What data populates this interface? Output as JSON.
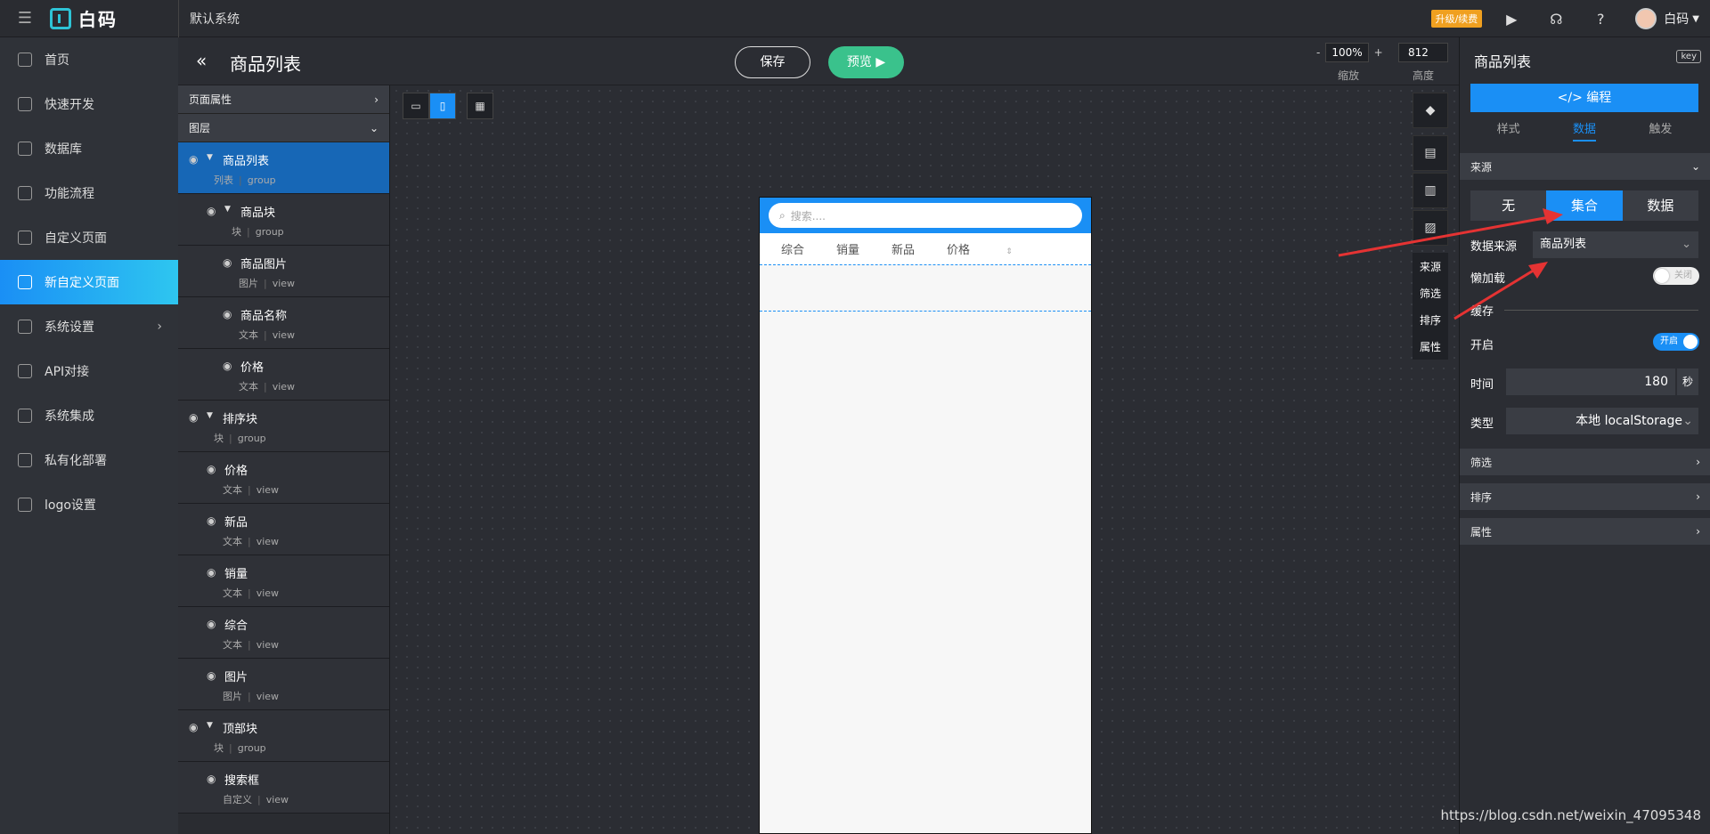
{
  "topbar": {
    "system": "默认系统",
    "logo": "白码",
    "upgrade": "升级/续费",
    "user": "白码"
  },
  "sidebar": {
    "items": [
      {
        "label": "首页",
        "icon": "home-icon"
      },
      {
        "label": "快速开发",
        "icon": "cube-icon"
      },
      {
        "label": "数据库",
        "icon": "database-icon"
      },
      {
        "label": "功能流程",
        "icon": "flow-icon"
      },
      {
        "label": "自定义页面",
        "icon": "page-icon"
      },
      {
        "label": "新自定义页面",
        "icon": "new-page-icon",
        "active": true
      },
      {
        "label": "系统设置",
        "icon": "chart-icon",
        "arrow": true
      },
      {
        "label": "API对接",
        "icon": "api-icon"
      },
      {
        "label": "系统集成",
        "icon": "layers-icon"
      },
      {
        "label": "私有化部署",
        "icon": "lock-icon"
      },
      {
        "label": "logo设置",
        "icon": "logo-icon"
      }
    ]
  },
  "header": {
    "title": "商品列表",
    "save": "保存",
    "preview": "预览",
    "zoom": "100%",
    "zoom_label": "缩放",
    "height": "812",
    "height_label": "高度"
  },
  "layers": {
    "page_props": "页面属性",
    "layer_head": "图层",
    "items": [
      {
        "name": "商品列表",
        "type": "列表",
        "kind": "group",
        "level": 0,
        "tri": true,
        "selected": true
      },
      {
        "name": "商品块",
        "type": "块",
        "kind": "group",
        "level": 1,
        "tri": true
      },
      {
        "name": "商品图片",
        "type": "图片",
        "kind": "view",
        "level": 2
      },
      {
        "name": "商品名称",
        "type": "文本",
        "kind": "view",
        "level": 2
      },
      {
        "name": "价格",
        "type": "文本",
        "kind": "view",
        "level": 2
      },
      {
        "name": "排序块",
        "type": "块",
        "kind": "group",
        "level": 0,
        "tri": true
      },
      {
        "name": "价格",
        "type": "文本",
        "kind": "view",
        "level": 1
      },
      {
        "name": "新品",
        "type": "文本",
        "kind": "view",
        "level": 1
      },
      {
        "name": "销量",
        "type": "文本",
        "kind": "view",
        "level": 1
      },
      {
        "name": "综合",
        "type": "文本",
        "kind": "view",
        "level": 1
      },
      {
        "name": "图片",
        "type": "图片",
        "kind": "view",
        "level": 1
      },
      {
        "name": "顶部块",
        "type": "块",
        "kind": "group",
        "level": 0,
        "tri": true
      },
      {
        "name": "搜索框",
        "type": "自定义",
        "kind": "view",
        "level": 1
      }
    ]
  },
  "phone": {
    "search_placeholder": "搜索....",
    "tabs": [
      "综合",
      "销量",
      "新品",
      "价格"
    ]
  },
  "vtools": {
    "labels": [
      "来源",
      "筛选",
      "排序",
      "属性"
    ]
  },
  "right": {
    "title": "商品列表",
    "key": "key",
    "code": "</> 编程",
    "tabs": [
      "样式",
      "数据",
      "触发"
    ],
    "source_head": "来源",
    "segments": [
      "无",
      "集合",
      "数据"
    ],
    "ds_label": "数据来源",
    "ds_value": "商品列表",
    "lazy_label": "懒加载",
    "lazy_state": "关闭",
    "cache_label": "缓存",
    "enable_label": "开启",
    "enable_state": "开启",
    "time_label": "时间",
    "time_value": "180",
    "time_unit": "秒",
    "type_label": "类型",
    "type_value": "本地 localStorage",
    "filter": "筛选",
    "sort": "排序",
    "attr": "属性"
  },
  "watermark": "https://blog.csdn.net/weixin_47095348"
}
